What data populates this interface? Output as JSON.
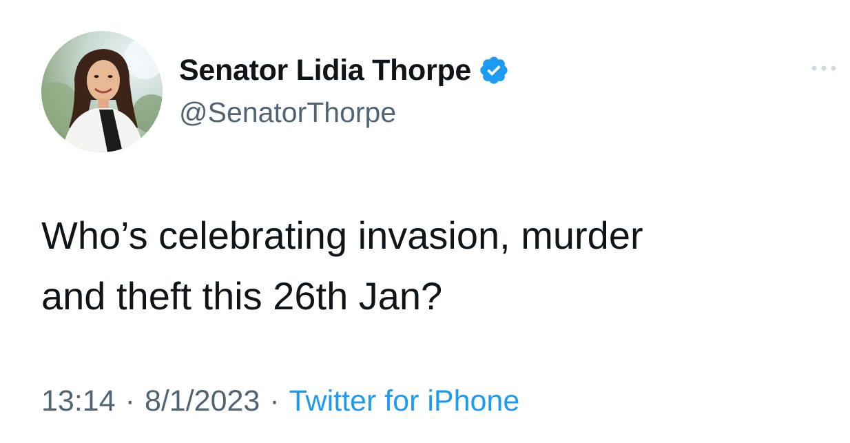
{
  "tweet": {
    "author": {
      "display_name": "Senator Lidia Thorpe",
      "handle": "@SenatorThorpe",
      "verified_icon": "verified-badge-icon",
      "avatar_icon": "profile-photo"
    },
    "more_icon": "more-options-icon",
    "text": "Who’s celebrating invasion, murder\nand theft this 26th Jan?",
    "time": "13:14",
    "separator": "·",
    "date": "8/1/2023",
    "source": "Twitter for iPhone"
  },
  "colors": {
    "primary_text": "#0f1419",
    "secondary_text": "#536471",
    "link": "#1d9bf0",
    "verified_badge": "#1d9bf0",
    "background": "#ffffff"
  }
}
